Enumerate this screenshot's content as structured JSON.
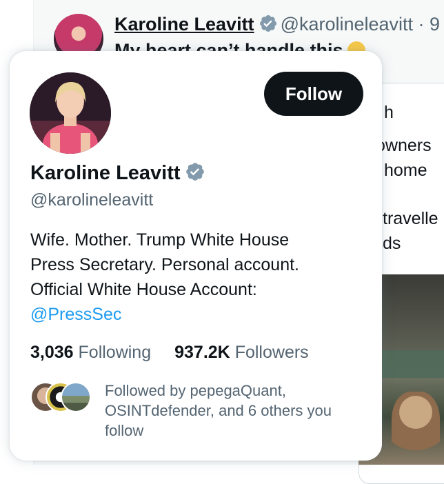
{
  "background_tweet": {
    "author_name": "Karoline Leavitt",
    "author_handle": "@karolineleavitt · 9",
    "text": "My heart can’t handle this",
    "quote_lines": [
      "h",
      "owners",
      "home",
      "travelle",
      "ds"
    ]
  },
  "hover_card": {
    "follow_label": "Follow",
    "display_name": "Karoline Leavitt",
    "handle": "@karolineleavitt",
    "bio_lines": [
      "Wife. Mother. Trump White House",
      "Press Secretary. Personal account.",
      "Official White House Account:"
    ],
    "bio_mention": "@PressSec",
    "following_count": "3,036",
    "following_label": "Following",
    "followers_count": "937.2K",
    "followers_label": "Followers",
    "followed_by_text": "Followed by pepegaQuant, OSINTdefender, and 6 others you follow"
  },
  "icons": {
    "verified": "verified-badge-icon",
    "emoji": "face-emoji-icon"
  },
  "colors": {
    "verified_badge": "#829aab",
    "link": "#1d9bf0",
    "secondary_text": "#536471",
    "button_bg": "#0f1419"
  }
}
